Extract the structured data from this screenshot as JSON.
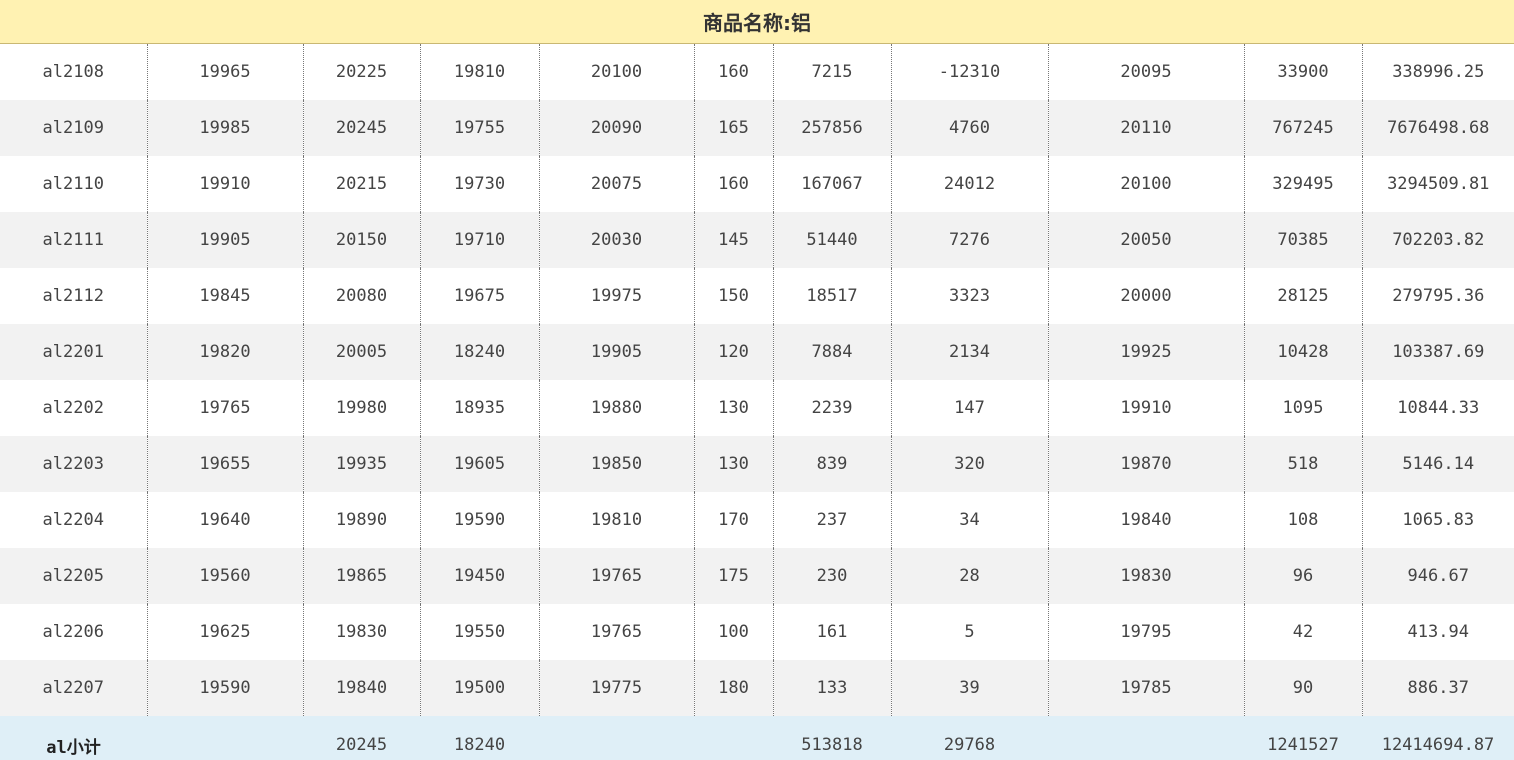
{
  "title": "商品名称:铝",
  "rows": [
    [
      "al2108",
      "19965",
      "20225",
      "19810",
      "20100",
      "160",
      "7215",
      "-12310",
      "20095",
      "33900",
      "338996.25"
    ],
    [
      "al2109",
      "19985",
      "20245",
      "19755",
      "20090",
      "165",
      "257856",
      "4760",
      "20110",
      "767245",
      "7676498.68"
    ],
    [
      "al2110",
      "19910",
      "20215",
      "19730",
      "20075",
      "160",
      "167067",
      "24012",
      "20100",
      "329495",
      "3294509.81"
    ],
    [
      "al2111",
      "19905",
      "20150",
      "19710",
      "20030",
      "145",
      "51440",
      "7276",
      "20050",
      "70385",
      "702203.82"
    ],
    [
      "al2112",
      "19845",
      "20080",
      "19675",
      "19975",
      "150",
      "18517",
      "3323",
      "20000",
      "28125",
      "279795.36"
    ],
    [
      "al2201",
      "19820",
      "20005",
      "18240",
      "19905",
      "120",
      "7884",
      "2134",
      "19925",
      "10428",
      "103387.69"
    ],
    [
      "al2202",
      "19765",
      "19980",
      "18935",
      "19880",
      "130",
      "2239",
      "147",
      "19910",
      "1095",
      "10844.33"
    ],
    [
      "al2203",
      "19655",
      "19935",
      "19605",
      "19850",
      "130",
      "839",
      "320",
      "19870",
      "518",
      "5146.14"
    ],
    [
      "al2204",
      "19640",
      "19890",
      "19590",
      "19810",
      "170",
      "237",
      "34",
      "19840",
      "108",
      "1065.83"
    ],
    [
      "al2205",
      "19560",
      "19865",
      "19450",
      "19765",
      "175",
      "230",
      "28",
      "19830",
      "96",
      "946.67"
    ],
    [
      "al2206",
      "19625",
      "19830",
      "19550",
      "19765",
      "100",
      "161",
      "5",
      "19795",
      "42",
      "413.94"
    ],
    [
      "al2207",
      "19590",
      "19840",
      "19500",
      "19775",
      "180",
      "133",
      "39",
      "19785",
      "90",
      "886.37"
    ]
  ],
  "subtotal": [
    "al小计",
    "",
    "20245",
    "18240",
    "",
    "",
    "513818",
    "29768",
    "",
    "1241527",
    "12414694.87"
  ]
}
